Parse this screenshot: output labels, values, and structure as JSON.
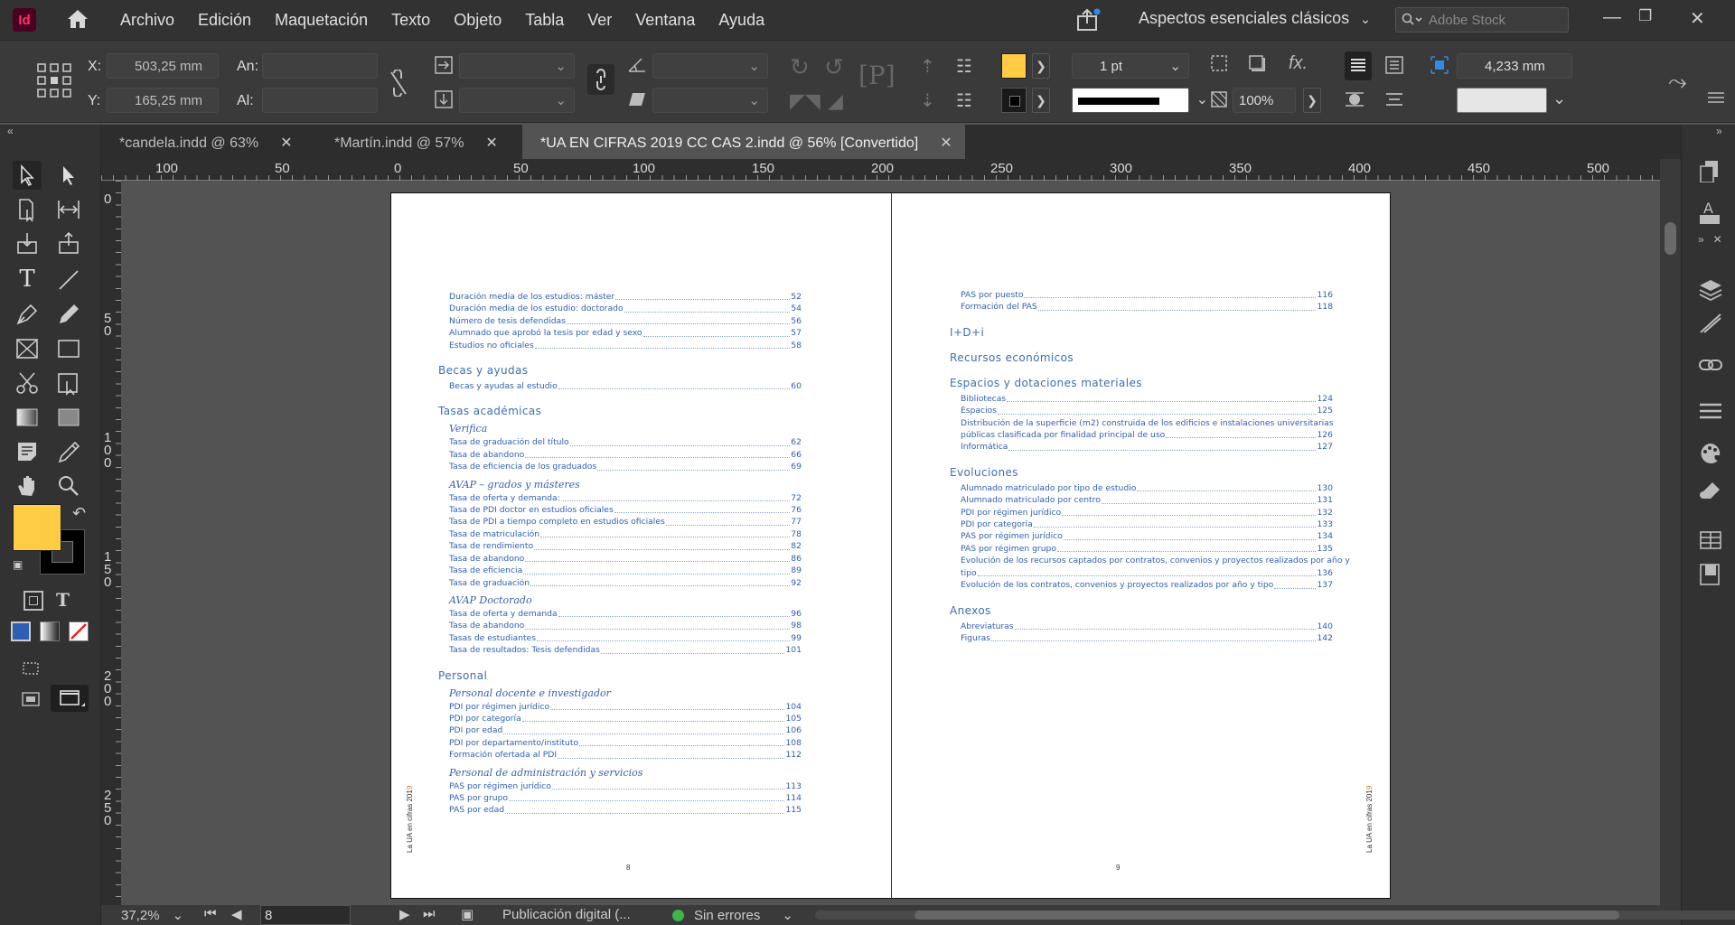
{
  "menubar": {
    "logo": "Id",
    "items": [
      "Archivo",
      "Edición",
      "Maquetación",
      "Texto",
      "Objeto",
      "Tabla",
      "Ver",
      "Ventana",
      "Ayuda"
    ],
    "workspace": "Aspectos esenciales clásicos",
    "search_placeholder": "Adobe Stock"
  },
  "control": {
    "x_label": "X:",
    "x_value": "503,25 mm",
    "y_label": "Y:",
    "y_value": "165,25 mm",
    "w_label": "An:",
    "w_value": "",
    "h_label": "Al:",
    "h_value": "",
    "stroke_weight": "1 pt",
    "opacity": "100%",
    "spacing_value": "4,233 mm",
    "fill_color": "#ffcc44",
    "stroke_color": "#000000"
  },
  "tabs": [
    {
      "label": "*candela.indd @ 63%",
      "active": false
    },
    {
      "label": "*Martín.indd @ 57%",
      "active": false
    },
    {
      "label": "*UA EN CIFRAS 2019 CC CAS 2.indd @ 56% [Convertido]",
      "active": true
    }
  ],
  "ruler": {
    "horizontal": [
      "100",
      "50",
      "0",
      "50",
      "100",
      "150",
      "200",
      "250",
      "300",
      "350",
      "400",
      "450",
      "500"
    ],
    "vertical": [
      "0",
      "50",
      "100",
      "150",
      "200",
      "250"
    ]
  },
  "left_page": {
    "groups": [
      {
        "type": "entries",
        "items": [
          {
            "t": "Duración media de los estudios: máster",
            "p": "52"
          },
          {
            "t": "Duración media de los estudio: doctorado",
            "p": "54"
          },
          {
            "t": "Número de tesis defendidas",
            "p": "56"
          },
          {
            "t": "Alumnado que aprobó la tesis por edad y sexo",
            "p": "57"
          },
          {
            "t": "Estudios no oficiales",
            "p": "58"
          }
        ]
      },
      {
        "type": "section",
        "title": "Becas y ayudas"
      },
      {
        "type": "entries",
        "items": [
          {
            "t": "Becas y ayudas al estudio",
            "p": "60"
          }
        ]
      },
      {
        "type": "section",
        "title": "Tasas académicas"
      },
      {
        "type": "subsection",
        "title": "Verifica"
      },
      {
        "type": "entries",
        "items": [
          {
            "t": "Tasa de graduación del título",
            "p": "62"
          },
          {
            "t": "Tasa de abandono",
            "p": "66"
          },
          {
            "t": "Tasa de eficiencia de los graduados",
            "p": "69"
          }
        ]
      },
      {
        "type": "subsection",
        "title": "AVAP – grados y másteres"
      },
      {
        "type": "entries",
        "items": [
          {
            "t": "Tasa de oferta y demanda:",
            "p": "72"
          },
          {
            "t": "Tasa de PDI doctor en estudios oficiales",
            "p": "76"
          },
          {
            "t": "Tasa de PDI a tiempo completo en estudios oficiales",
            "p": "77"
          },
          {
            "t": "Tasa de matriculación",
            "p": "78"
          },
          {
            "t": "Tasa de rendimiento",
            "p": "82"
          },
          {
            "t": "Tasa de abandono",
            "p": "86"
          },
          {
            "t": "Tasa de eficiencia",
            "p": "89"
          },
          {
            "t": "Tasa de graduación",
            "p": "92"
          }
        ]
      },
      {
        "type": "subsection",
        "title": "AVAP Doctorado"
      },
      {
        "type": "entries",
        "items": [
          {
            "t": "Tasa de oferta y demanda",
            "p": "96"
          },
          {
            "t": "Tasa de abandono",
            "p": "98"
          },
          {
            "t": "Tasas de estudiantes",
            "p": "99"
          },
          {
            "t": "Tasa de resultados: Tesis defendidas",
            "p": "101"
          }
        ]
      },
      {
        "type": "section",
        "title": "Personal"
      },
      {
        "type": "subsection",
        "title": "Personal docente e investigador"
      },
      {
        "type": "entries",
        "items": [
          {
            "t": "PDI por régimen jurídico",
            "p": "104"
          },
          {
            "t": "PDI por categoría",
            "p": "105"
          },
          {
            "t": "PDI por edad",
            "p": "106"
          },
          {
            "t": "PDI por departamento/instituto",
            "p": "108"
          },
          {
            "t": "Formación ofertada al PDI",
            "p": "112"
          }
        ]
      },
      {
        "type": "subsection",
        "title": "Personal de administración y servicios"
      },
      {
        "type": "entries",
        "items": [
          {
            "t": "PAS por régimen jurídico",
            "p": "113"
          },
          {
            "t": "PAS por grupo",
            "p": "114"
          },
          {
            "t": "PAS por edad",
            "p": "115"
          }
        ]
      }
    ],
    "page_number": "8",
    "side_text": "La UA en cifras 201",
    "side_text_accent": "9"
  },
  "right_page": {
    "groups": [
      {
        "type": "entries",
        "items": [
          {
            "t": "PAS por puesto",
            "p": "116"
          },
          {
            "t": "Formación del PAS",
            "p": "118"
          }
        ]
      },
      {
        "type": "section",
        "title": "I+D+i"
      },
      {
        "type": "section",
        "title": "Recursos económicos"
      },
      {
        "type": "section",
        "title": "Espacios y dotaciones materiales"
      },
      {
        "type": "entries",
        "items": [
          {
            "t": "Bibliotecas",
            "p": "124"
          },
          {
            "t": "Espacios",
            "p": "125"
          },
          {
            "t": "Distribución de la superficie (m2) construida de los edificios e instalaciones universitarias",
            "p": ""
          },
          {
            "t": "públicas clasificada por finalidad principal de uso",
            "p": "126"
          },
          {
            "t": "Informática",
            "p": "127"
          }
        ]
      },
      {
        "type": "section",
        "title": "Evoluciones"
      },
      {
        "type": "entries",
        "items": [
          {
            "t": "Alumnado matriculado por tipo de estudio",
            "p": "130"
          },
          {
            "t": "Alumnado matriculado por centro",
            "p": "131"
          },
          {
            "t": "PDI por régimen jurídico",
            "p": "132"
          },
          {
            "t": "PDI por categoría",
            "p": "133"
          },
          {
            "t": "PAS por régimen jurídico",
            "p": "134"
          },
          {
            "t": "PAS por régimen grupo",
            "p": "135"
          },
          {
            "t": "Evolución de los recursos captados por contratos, convenios y proyectos realizados por año y",
            "p": ""
          },
          {
            "t": "tipo",
            "p": "136"
          },
          {
            "t": "Evolución de los contratos, convenios y proyectos realizados por año y tipo",
            "p": "137"
          }
        ]
      },
      {
        "type": "section",
        "title": "Anexos"
      },
      {
        "type": "entries",
        "items": [
          {
            "t": "Abreviaturas",
            "p": "140"
          },
          {
            "t": "Figuras",
            "p": "142"
          }
        ]
      }
    ],
    "page_number": "9",
    "side_text": "La UA en cifras 201",
    "side_text_accent": "9"
  },
  "status": {
    "zoom": "37,2%",
    "page": "8",
    "profile": "Publicación digital (...",
    "preflight": "Sin errores"
  }
}
